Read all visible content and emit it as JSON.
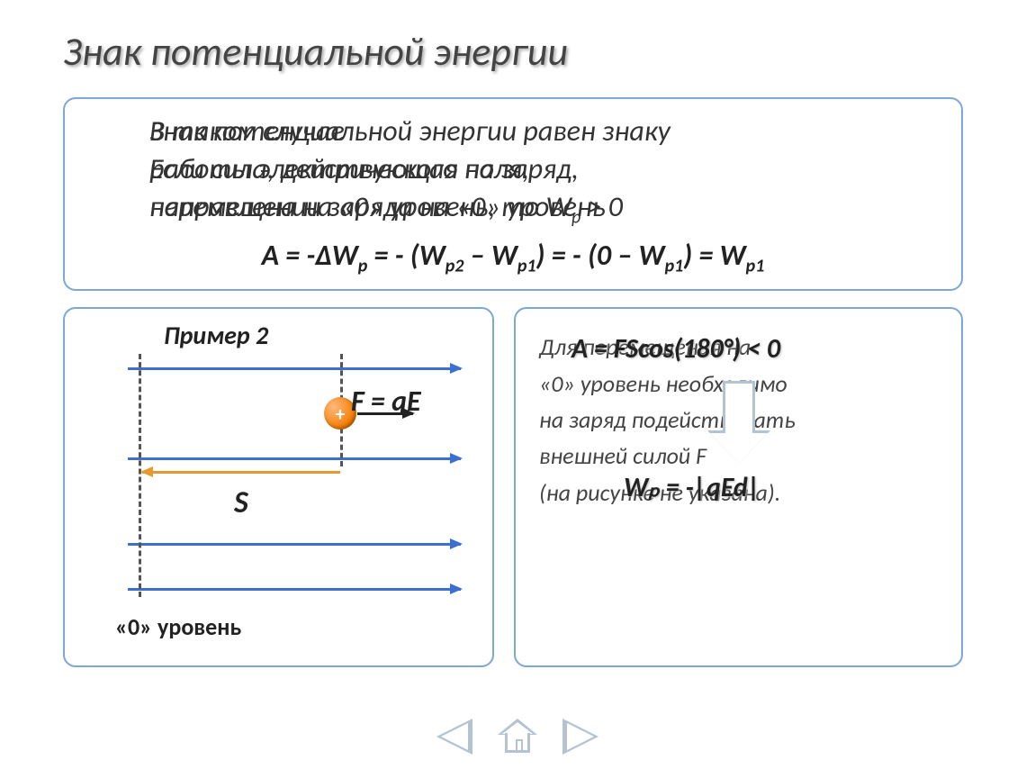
{
  "title": "Знак потенциальной энергии",
  "top": {
    "line1_a": "Знак потенциальной энергии равен знаку",
    "line1_b": "В таком случае",
    "line2_a": "работы электрического поля,",
    "line2_b": "Если сила, действующая на заряд,",
    "line3_a": "направлена на «0» уровень, то W",
    "line3_b": "перемещении заряда на «0» уровень",
    "line3_c": " > 0",
    "formula": "A = -ΔWₚ = - (Wₚ₂ – Wₚ₁) = - (0 – Wₚ₁) = Wₚ₁"
  },
  "left": {
    "example": "Пример 2",
    "f_eq": "F = qE",
    "s": "S",
    "zero": "«0» уровень",
    "charge": "+"
  },
  "right": {
    "text_l1": "Для перемещения на",
    "text_l2": "«0» уровень необходимо",
    "text_l3": "на заряд подействовать",
    "text_l4": "внешней силой F",
    "text_l5": "(на рисунке не указана).",
    "formula1": "A = FScos(180°) < 0",
    "formula2": "Wₚ = -|qEd|"
  }
}
